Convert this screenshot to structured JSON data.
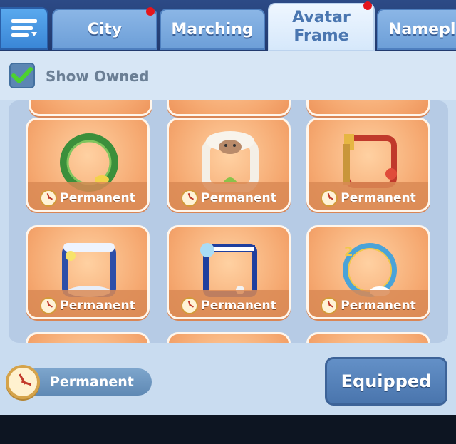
{
  "tabs": [
    {
      "label": "City",
      "has_dot": true
    },
    {
      "label": "Marching",
      "has_dot": false
    },
    {
      "label": "Avatar Frame",
      "active": true,
      "has_dot": true
    },
    {
      "label": "Namepla",
      "has_dot": false
    }
  ],
  "filter": {
    "label": "Show Owned",
    "checked": true
  },
  "cards": [
    {
      "label": "Permanent",
      "frame": "green-wreath-frame"
    },
    {
      "label": "Permanent",
      "frame": "sheep-frame"
    },
    {
      "label": "Permanent",
      "frame": "train-frame"
    },
    {
      "label": "Permanent",
      "frame": "snow-frame"
    },
    {
      "label": "Permanent",
      "frame": "circus-frame"
    },
    {
      "label": "Permanent",
      "frame": "celebration-frame"
    }
  ],
  "footer": {
    "duration_label": "Permanent",
    "action_label": "Equipped"
  },
  "colors": {
    "accent": "#4a75ad",
    "card": "#f5a870",
    "dot": "#e5151b"
  }
}
